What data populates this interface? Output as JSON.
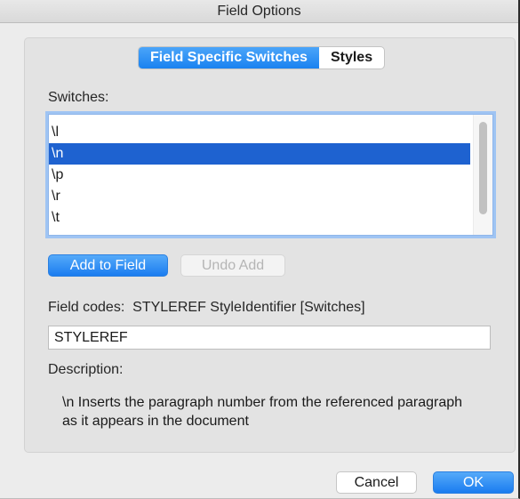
{
  "window": {
    "title": "Field Options"
  },
  "tabs": [
    {
      "label": "Field Specific Switches",
      "active": true
    },
    {
      "label": "Styles",
      "active": false
    }
  ],
  "switches": {
    "label": "Switches:",
    "items": [
      "\\l",
      "\\n",
      "\\p",
      "\\r",
      "\\t"
    ],
    "selected_index": 1
  },
  "buttons": {
    "add_to_field": "Add to Field",
    "undo_add": "Undo Add",
    "cancel": "Cancel",
    "ok": "OK"
  },
  "field_codes": {
    "label": "Field codes:",
    "syntax": "STYLEREF StyleIdentifier [Switches]",
    "value": "STYLEREF"
  },
  "description": {
    "label": "Description:",
    "text": "\\n Inserts the paragraph number from the referenced paragraph as it appears in the document"
  },
  "colors": {
    "accent": "#1a82f0",
    "selection": "#1e62d0",
    "focus_ring": "#9fc4f3"
  }
}
